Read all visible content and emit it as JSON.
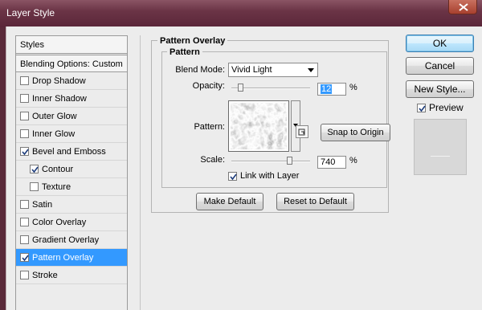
{
  "window": {
    "title": "Layer Style"
  },
  "sidebar": {
    "header": "Styles",
    "blending_label": "Blending Options: Custom",
    "items": [
      {
        "label": "Drop Shadow",
        "checked": false
      },
      {
        "label": "Inner Shadow",
        "checked": false
      },
      {
        "label": "Outer Glow",
        "checked": false
      },
      {
        "label": "Inner Glow",
        "checked": false
      },
      {
        "label": "Bevel and Emboss",
        "checked": true
      },
      {
        "label": "Contour",
        "checked": true,
        "indent": true
      },
      {
        "label": "Texture",
        "checked": false,
        "indent": true
      },
      {
        "label": "Satin",
        "checked": false
      },
      {
        "label": "Color Overlay",
        "checked": false
      },
      {
        "label": "Gradient Overlay",
        "checked": false
      },
      {
        "label": "Pattern Overlay",
        "checked": true,
        "selected": true
      },
      {
        "label": "Stroke",
        "checked": false
      }
    ]
  },
  "panel": {
    "group_title": "Pattern Overlay",
    "subgroup_title": "Pattern",
    "blend_mode_label": "Blend Mode:",
    "blend_mode_value": "Vivid Light",
    "opacity_label": "Opacity:",
    "opacity_value": "12",
    "opacity_fraction": 0.12,
    "percent": "%",
    "pattern_label": "Pattern:",
    "snap_button": "Snap to Origin",
    "scale_label": "Scale:",
    "scale_value": "740",
    "scale_fraction": 0.74,
    "link_label": "Link with Layer",
    "link_checked": true,
    "make_default": "Make Default",
    "reset_default": "Reset to Default"
  },
  "actions": {
    "ok": "OK",
    "cancel": "Cancel",
    "new_style": "New Style...",
    "preview_label": "Preview",
    "preview_checked": true
  },
  "colors": {
    "selection": "#3399ff",
    "titlebar": "#6b3446"
  }
}
